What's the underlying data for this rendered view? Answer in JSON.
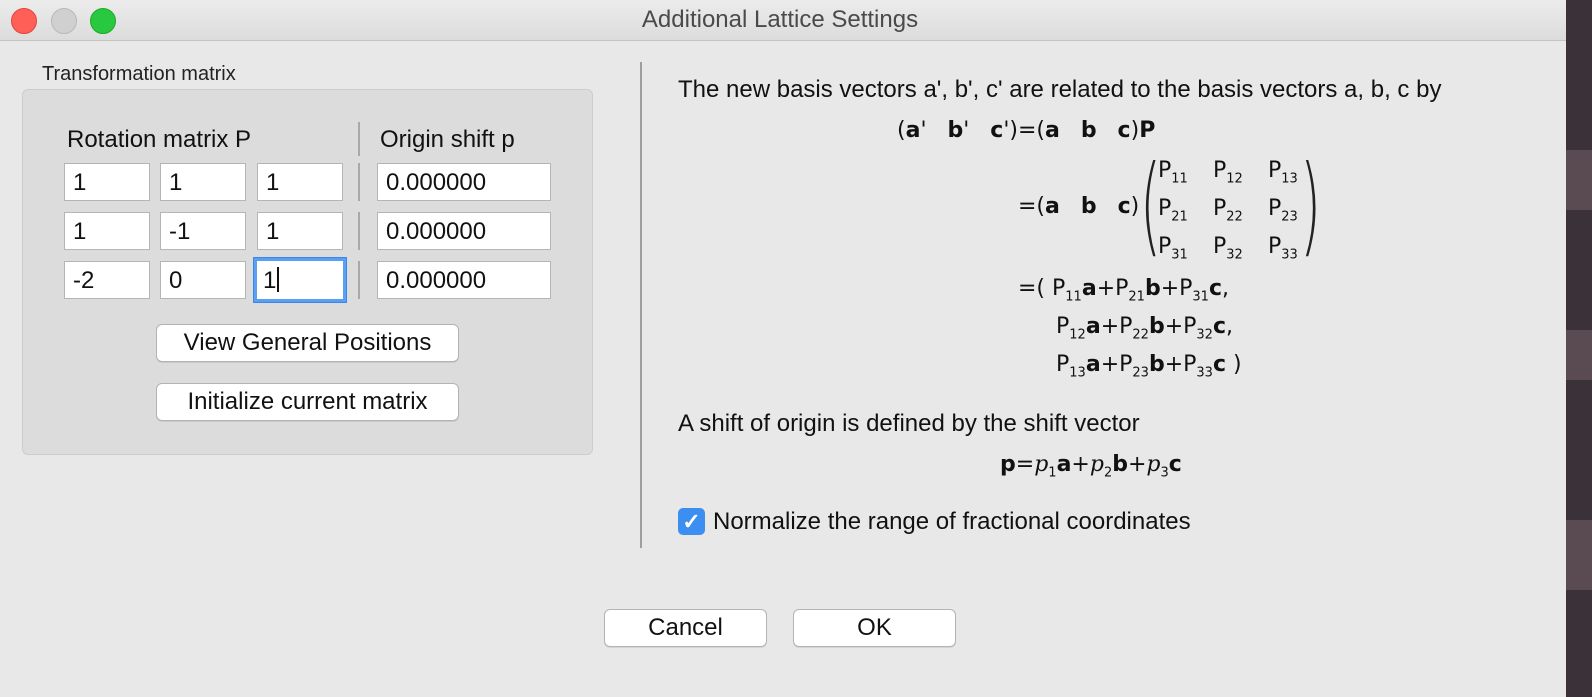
{
  "window": {
    "title": "Additional Lattice Settings"
  },
  "transformation": {
    "group_title": "Transformation matrix",
    "rotation_header": "Rotation matrix P",
    "origin_header": "Origin shift p",
    "rows": [
      {
        "p": [
          "1",
          "1",
          "1"
        ],
        "shift": "0.000000"
      },
      {
        "p": [
          "1",
          "-1",
          "1"
        ],
        "shift": "0.000000"
      },
      {
        "p": [
          "-2",
          "0",
          "1"
        ],
        "shift": "0.000000"
      }
    ],
    "view_button": "View General Positions",
    "init_button": "Initialize current matrix"
  },
  "explanation": {
    "intro": "The new basis vectors a', b', c' are related to the basis vectors a, b, c by",
    "shift_text": "A shift of origin is defined by the shift vector"
  },
  "normalize": {
    "label": "Normalize the range of fractional coordinates",
    "checked": true
  },
  "footer": {
    "cancel": "Cancel",
    "ok": "OK"
  },
  "colors": {
    "accent": "#3c8ef0",
    "focus_ring": "#5aa0f2",
    "close": "#ff5f57",
    "zoom": "#28c840"
  }
}
